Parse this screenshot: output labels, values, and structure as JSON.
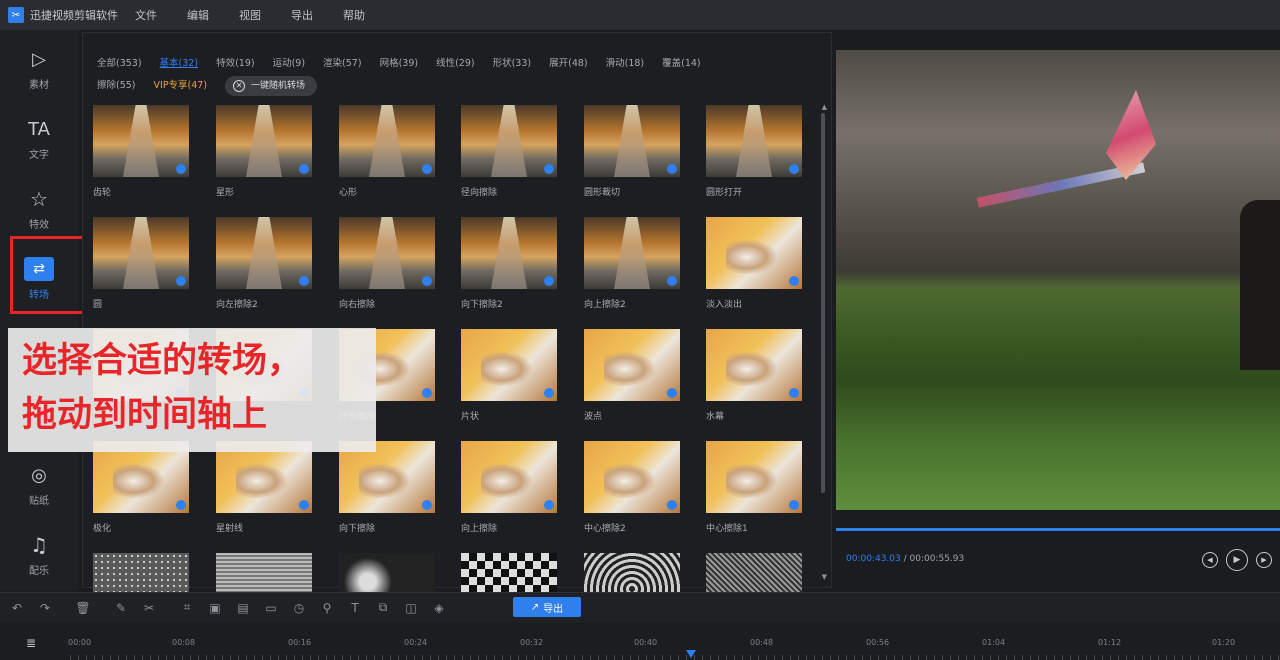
{
  "menubar": {
    "app_name": "迅捷视频剪辑软件",
    "items": [
      "文件",
      "编辑",
      "视图",
      "导出",
      "帮助"
    ]
  },
  "sidebar": {
    "items": [
      {
        "label": "素材",
        "icon": "play-folder-icon",
        "glyph": "▷"
      },
      {
        "label": "文字",
        "icon": "text-icon",
        "glyph": "TA"
      },
      {
        "label": "特效",
        "icon": "sparkle-icon",
        "glyph": "☆"
      },
      {
        "label": "转场",
        "icon": "transition-icon",
        "glyph": "⇄"
      },
      {
        "label": "贴纸",
        "icon": "sticker-icon",
        "glyph": "◎"
      },
      {
        "label": "配乐",
        "icon": "music-icon",
        "glyph": "♫"
      }
    ],
    "active_index": 3
  },
  "library": {
    "categories_row1": [
      "全部(353)",
      "基本(32)",
      "特效(19)",
      "运动(9)",
      "渲染(57)",
      "网格(39)",
      "线性(29)",
      "形状(33)",
      "展开(48)",
      "滑动(18)",
      "覆盖(14)"
    ],
    "categories_row2": [
      "擦除(55)",
      "VIP专享(47)"
    ],
    "active_category": "基本(32)",
    "random_button": "一键随机转场",
    "tiles": [
      {
        "name": "齿轮",
        "style": "alley"
      },
      {
        "name": "星形",
        "style": "alley"
      },
      {
        "name": "心形",
        "style": "alley"
      },
      {
        "name": "径向擦除",
        "style": "alley"
      },
      {
        "name": "圆形裁切",
        "style": "alley"
      },
      {
        "name": "圆形打开",
        "style": "alley"
      },
      {
        "name": "圆",
        "style": "alley"
      },
      {
        "name": "向左擦除2",
        "style": "alley"
      },
      {
        "name": "向右擦除",
        "style": "alley"
      },
      {
        "name": "向下擦除2",
        "style": "alley"
      },
      {
        "name": "向上擦除2",
        "style": "alley"
      },
      {
        "name": "淡入淡出",
        "style": "cat"
      },
      {
        "name": "",
        "style": "cat"
      },
      {
        "name": "",
        "style": "cat"
      },
      {
        "name": "环状擦除",
        "style": "cat"
      },
      {
        "name": "片状",
        "style": "cat"
      },
      {
        "name": "波点",
        "style": "cat"
      },
      {
        "name": "水幕",
        "style": "cat"
      },
      {
        "name": "极化",
        "style": "cat"
      },
      {
        "name": "星射线",
        "style": "cat"
      },
      {
        "name": "向下擦除",
        "style": "cat"
      },
      {
        "name": "向上擦除",
        "style": "cat"
      },
      {
        "name": "中心擦除2",
        "style": "cat"
      },
      {
        "name": "中心擦除1",
        "style": "cat"
      },
      {
        "name": "",
        "style": "dot"
      },
      {
        "name": "",
        "style": "line"
      },
      {
        "name": "",
        "style": "circle"
      },
      {
        "name": "",
        "style": "check"
      },
      {
        "name": "",
        "style": "swirl"
      },
      {
        "name": "",
        "style": "noise"
      }
    ]
  },
  "overlay": {
    "line1": "选择合适的转场，",
    "line2": "拖动到时间轴上"
  },
  "preview": {
    "current_time": "00:00:43.03",
    "separator": " / ",
    "total_time": "00:00:55.93"
  },
  "toolbar": {
    "export_label": "导出",
    "tools": [
      "undo-icon",
      "redo-icon",
      "delete-icon",
      "edit-icon",
      "cut-icon",
      "crop-icon",
      "mosaic-icon",
      "freeze-icon",
      "split-icon",
      "speed-icon",
      "record-icon",
      "text-add-icon",
      "copy-icon",
      "snapshot-icon",
      "color-icon"
    ]
  },
  "timeline": {
    "ticks": [
      "00:00",
      "00:08",
      "00:16",
      "00:24",
      "00:32",
      "00:40",
      "00:48",
      "00:56",
      "01:04",
      "01:12",
      "01:20"
    ]
  }
}
